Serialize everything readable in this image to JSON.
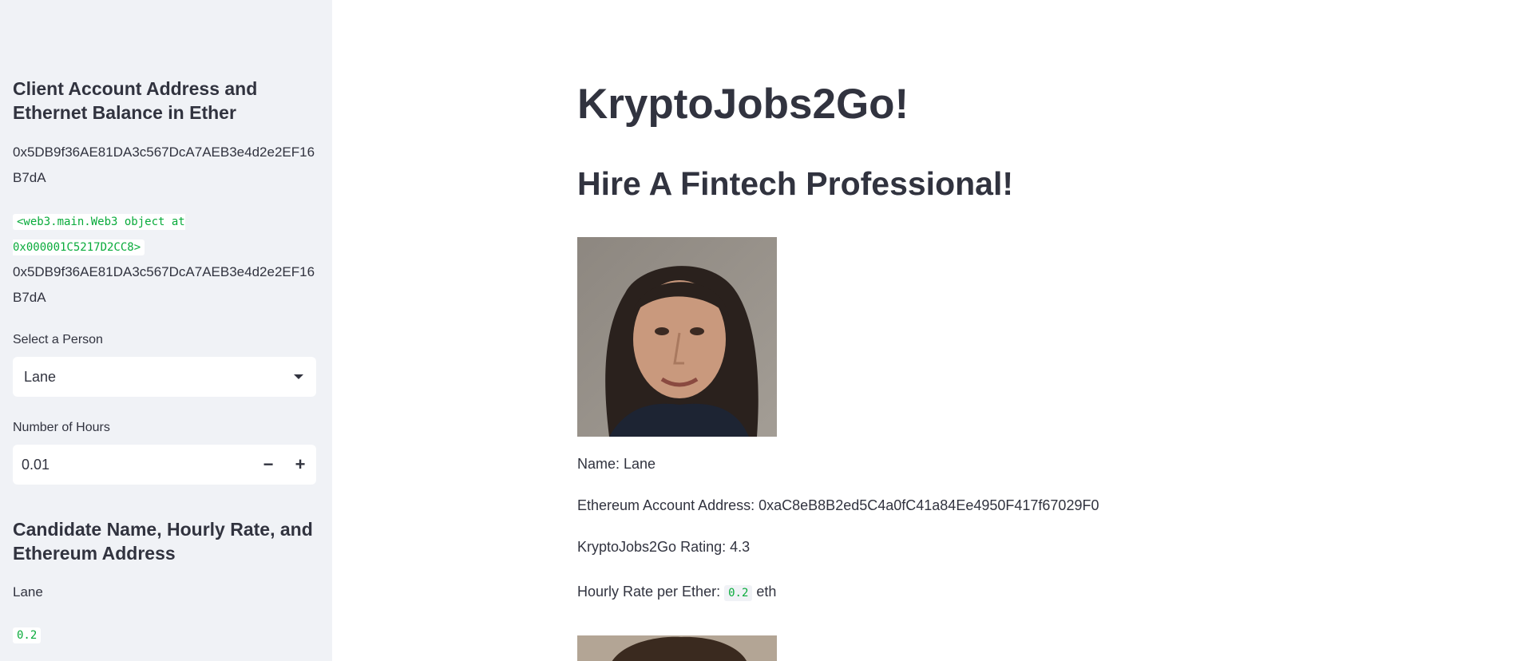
{
  "sidebar": {
    "heading1": "Client Account Address and Ethernet Balance in Ether",
    "address": "0x5DB9f36AE81DA3c567DcA7AEB3e4d2e2EF16B7dA",
    "web3_object": "<web3.main.Web3 object at 0x000001C5217D2CC8>",
    "address2": "0x5DB9f36AE81DA3c567DcA7AEB3e4d2e2EF16B7dA",
    "select_label": "Select a Person",
    "select_value": "Lane",
    "hours_label": "Number of Hours",
    "hours_value": "0.01",
    "minus": "−",
    "plus": "+",
    "heading2": "Candidate Name, Hourly Rate, and Ethereum Address",
    "candidate_name": "Lane",
    "candidate_rate": "0.2"
  },
  "main": {
    "title": "KryptoJobs2Go!",
    "subtitle": "Hire A Fintech Professional!",
    "name_line": "Name: Lane",
    "eth_line": "Ethereum Account Address: 0xaC8eB8B2ed5C4a0fC41a84Ee4950F417f67029F0",
    "rating_line": "KryptoJobs2Go Rating: 4.3",
    "rate_prefix": "Hourly Rate per Ether:",
    "rate_value": "0.2",
    "rate_suffix": "eth"
  }
}
